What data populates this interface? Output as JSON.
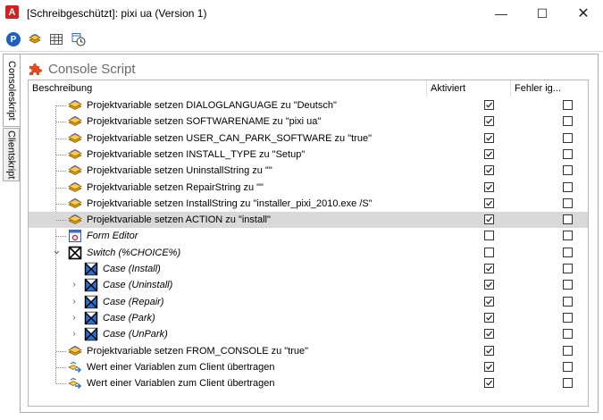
{
  "window": {
    "app_icon_letter": "A",
    "title": "[Schreibgeschützt]: pixi ua (Version 1)",
    "minimize_glyph": "—",
    "maximize_glyph": "☐",
    "close_glyph": "✕"
  },
  "toolbar": {
    "icons": [
      "p-badge-icon",
      "layers-icon",
      "grid-icon",
      "schedule-icon"
    ],
    "p_label": "P"
  },
  "side_tabs": [
    {
      "label": "Consoleskript",
      "active": true
    },
    {
      "label": "Clientskript",
      "active": false
    }
  ],
  "panel": {
    "title": "Console Script",
    "columns": {
      "description": "Beschreibung",
      "enabled": "Aktiviert",
      "ignore_errors": "Fehler ig..."
    },
    "rows": [
      {
        "label": "Projektvariable setzen DIALOGLANGUAGE zu \"Deutsch\"",
        "level": 1,
        "icon": "variable-icon",
        "enabled": true,
        "ignore": false
      },
      {
        "label": "Projektvariable setzen SOFTWARENAME zu \"pixi ua\"",
        "level": 1,
        "icon": "variable-icon",
        "enabled": true,
        "ignore": false
      },
      {
        "label": "Projektvariable setzen USER_CAN_PARK_SOFTWARE zu \"true\"",
        "level": 1,
        "icon": "variable-icon",
        "enabled": true,
        "ignore": false
      },
      {
        "label": "Projektvariable setzen INSTALL_TYPE zu \"Setup\"",
        "level": 1,
        "icon": "variable-icon",
        "enabled": true,
        "ignore": false
      },
      {
        "label": "Projektvariable setzen UninstallString zu \"\"",
        "level": 1,
        "icon": "variable-icon",
        "enabled": true,
        "ignore": false
      },
      {
        "label": "Projektvariable setzen RepairString zu \"\"",
        "level": 1,
        "icon": "variable-icon",
        "enabled": true,
        "ignore": false
      },
      {
        "label": "Projektvariable setzen InstallString zu \"installer_pixi_2010.exe /S\"",
        "level": 1,
        "icon": "variable-icon",
        "enabled": true,
        "ignore": false
      },
      {
        "label": "Projektvariable setzen ACTION zu \"install\"",
        "level": 1,
        "icon": "variable-icon",
        "enabled": true,
        "ignore": false,
        "selected": true
      },
      {
        "label": "Form Editor",
        "level": 1,
        "icon": "form-editor-icon",
        "enabled": false,
        "ignore": false,
        "italic": true
      },
      {
        "label": "Switch (%CHOICE%)",
        "level": 1,
        "icon": "switch-icon",
        "enabled": false,
        "ignore": false,
        "italic": true,
        "expander": "⌄"
      },
      {
        "label": "Case (Install)",
        "level": 2,
        "icon": "case-icon",
        "enabled": true,
        "ignore": false,
        "italic": true
      },
      {
        "label": "Case (Uninstall)",
        "level": 2,
        "icon": "case-icon",
        "enabled": true,
        "ignore": false,
        "italic": true,
        "expander": "›"
      },
      {
        "label": "Case (Repair)",
        "level": 2,
        "icon": "case-icon",
        "enabled": true,
        "ignore": false,
        "italic": true,
        "expander": "›"
      },
      {
        "label": "Case (Park)",
        "level": 2,
        "icon": "case-icon",
        "enabled": true,
        "ignore": false,
        "italic": true,
        "expander": "›"
      },
      {
        "label": "Case (UnPark)",
        "level": 2,
        "icon": "case-icon",
        "enabled": true,
        "ignore": false,
        "italic": true,
        "expander": "›"
      },
      {
        "label": "Projektvariable setzen FROM_CONSOLE zu \"true\"",
        "level": 1,
        "icon": "variable-icon",
        "enabled": true,
        "ignore": false
      },
      {
        "label": "Wert einer Variablen zum Client übertragen",
        "level": 1,
        "icon": "transfer-icon",
        "enabled": true,
        "ignore": false
      },
      {
        "label": "Wert einer Variablen zum Client übertragen",
        "level": 1,
        "icon": "transfer-icon",
        "enabled": true,
        "ignore": false
      }
    ]
  },
  "colors": {
    "accent_red": "#d42020",
    "accent_blue": "#1f5fbf",
    "selected_row": "#d9d9d9"
  }
}
